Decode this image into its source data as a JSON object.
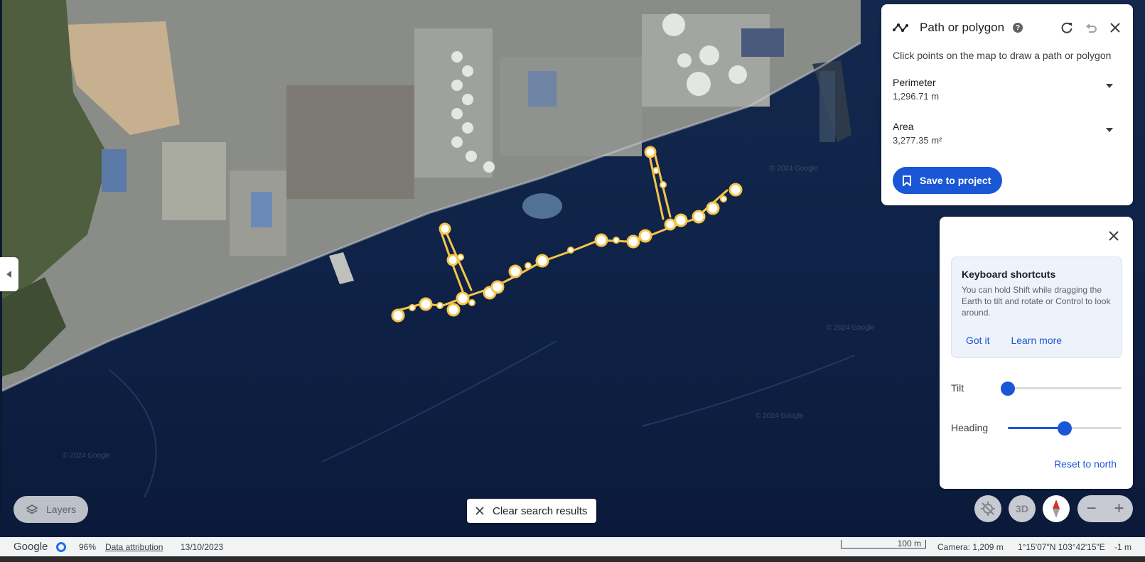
{
  "path_panel": {
    "title": "Path or polygon",
    "help_icon": "?",
    "instruction": "Click points on the map to draw a path or polygon",
    "perimeter_label": "Perimeter",
    "perimeter_value": "1,296.71 m",
    "area_label": "Area",
    "area_value": "3,277.35 m²",
    "save_label": "Save to project"
  },
  "nav_panel": {
    "shortcut_title": "Keyboard shortcuts",
    "shortcut_text": "You can hold Shift while dragging the Earth to tilt and rotate or Control to look around.",
    "got_it": "Got it",
    "learn_more": "Learn more",
    "tilt_label": "Tilt",
    "tilt_value": 0,
    "heading_label": "Heading",
    "heading_value": 0.5,
    "reset_north": "Reset to north"
  },
  "map": {
    "watermark": "© 2024 Google",
    "layers_label": "Layers",
    "clear_label": "Clear search results",
    "three_d_label": "3D",
    "zoom_out": "−",
    "zoom_in": "+"
  },
  "status_bar": {
    "logo": "Google",
    "percent": "96%",
    "attribution": "Data attribution",
    "date": "13/10/2023",
    "scale": "100 m",
    "camera": "Camera: 1,209 m",
    "coords": "1°15'07\"N 103°42'15\"E",
    "elevation": "-1 m"
  },
  "colors": {
    "accent": "#1a57d6",
    "path": "#f5c54a",
    "water": "#0f2247",
    "land": "#8b8f87"
  }
}
